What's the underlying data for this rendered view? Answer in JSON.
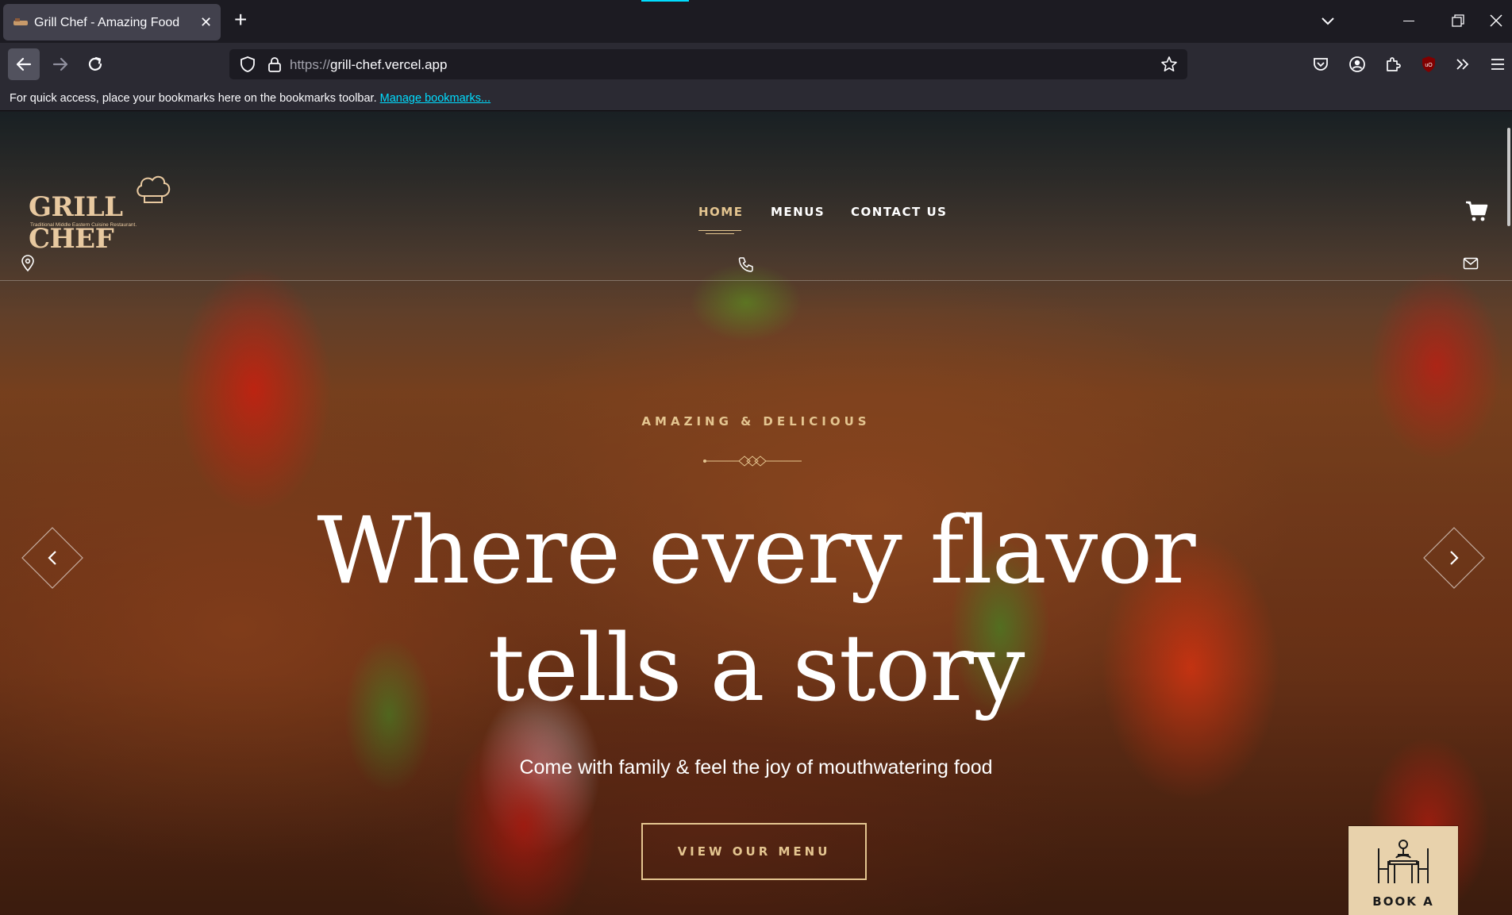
{
  "browser": {
    "tab_title": "Grill Chef - Amazing Food",
    "url_protocol": "https://",
    "url_host": "grill-chef.vercel.app",
    "bookmarks_text": "For quick access, place your bookmarks here on the bookmarks toolbar.",
    "bookmarks_link": "Manage bookmarks..."
  },
  "site": {
    "logo_text": "GRILL CHEF",
    "logo_tagline": "Traditional Middle Eastern Cuisine Restaurant.",
    "nav": {
      "home": "HOME",
      "menus": "MENUS",
      "contact": "CONTACT US"
    },
    "hero": {
      "kicker": "AMAZING & DELICIOUS",
      "headline_line1": "Where every flavor",
      "headline_line2": "tells a story",
      "subline": "Come with family & feel the joy of mouthwatering food",
      "cta": "VIEW OUR MENU"
    },
    "book_label": "BOOK A",
    "colors": {
      "accent": "#e4c590",
      "book_bg": "#e8d2ac"
    }
  }
}
